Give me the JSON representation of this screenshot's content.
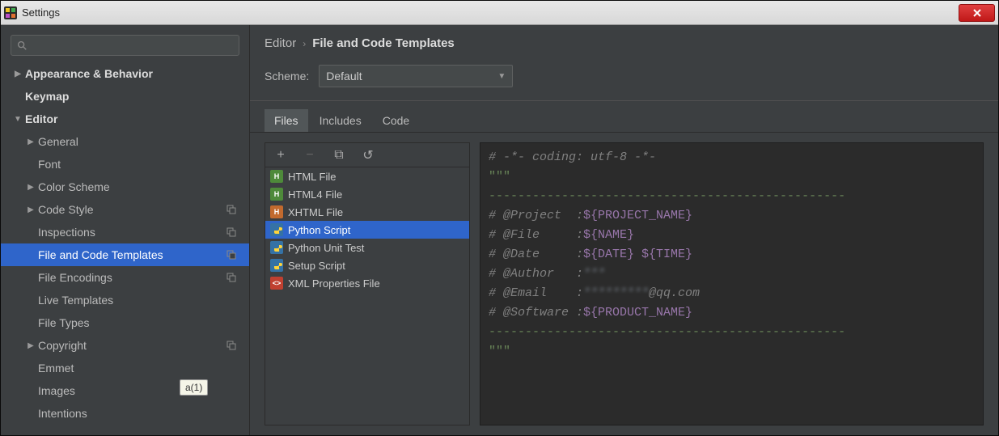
{
  "window": {
    "title": "Settings"
  },
  "sidebar": {
    "items": [
      {
        "label": "Appearance & Behavior",
        "arrow": "right",
        "bold": true,
        "level": 0
      },
      {
        "label": "Keymap",
        "arrow": "",
        "bold": true,
        "level": 0
      },
      {
        "label": "Editor",
        "arrow": "down",
        "bold": true,
        "level": 0
      },
      {
        "label": "General",
        "arrow": "right",
        "level": 1
      },
      {
        "label": "Font",
        "arrow": "",
        "level": 1
      },
      {
        "label": "Color Scheme",
        "arrow": "right",
        "level": 1
      },
      {
        "label": "Code Style",
        "arrow": "right",
        "level": 1,
        "tagged": true
      },
      {
        "label": "Inspections",
        "arrow": "",
        "level": 1,
        "tagged": true
      },
      {
        "label": "File and Code Templates",
        "arrow": "",
        "level": 1,
        "tagged": true,
        "selected": true
      },
      {
        "label": "File Encodings",
        "arrow": "",
        "level": 1,
        "tagged": true
      },
      {
        "label": "Live Templates",
        "arrow": "",
        "level": 1
      },
      {
        "label": "File Types",
        "arrow": "",
        "level": 1
      },
      {
        "label": "Copyright",
        "arrow": "right",
        "level": 1,
        "tagged": true
      },
      {
        "label": "Emmet",
        "arrow": "",
        "level": 1
      },
      {
        "label": "Images",
        "arrow": "",
        "level": 1
      },
      {
        "label": "Intentions",
        "arrow": "",
        "level": 1
      }
    ]
  },
  "breadcrumb": {
    "root": "Editor",
    "current": "File and Code Templates"
  },
  "scheme": {
    "label": "Scheme:",
    "value": "Default"
  },
  "tabs": [
    {
      "label": "Files",
      "active": true
    },
    {
      "label": "Includes"
    },
    {
      "label": "Code"
    }
  ],
  "templates": [
    {
      "label": "HTML File",
      "icon": "html"
    },
    {
      "label": "HTML4 File",
      "icon": "html"
    },
    {
      "label": "XHTML File",
      "icon": "xhtml"
    },
    {
      "label": "Python Script",
      "icon": "py",
      "selected": true
    },
    {
      "label": "Python Unit Test",
      "icon": "py"
    },
    {
      "label": "Setup Script",
      "icon": "py"
    },
    {
      "label": "XML Properties File",
      "icon": "xml"
    }
  ],
  "toolbar_icons": {
    "add": "+",
    "remove": "−",
    "copy": "⧉",
    "revert": "↺"
  },
  "code": {
    "l1_a": "# -*- coding: utf-8 -*-",
    "l2": "\"\"\"",
    "dash": "-------------------------------------------------",
    "l4_a": "# @Project  :",
    "l4_b": "${PROJECT_NAME}",
    "l5_a": "# @File     :",
    "l5_b": "${NAME}",
    "l6_a": "# @Date     :",
    "l6_b": "${DATE} ${TIME}",
    "l7_a": "# @Author   :",
    "l7_b": "***",
    "l8_a": "# @Email    :",
    "l8_b": "*********",
    "l8_c": "@qq.com",
    "l9_a": "# @Software :",
    "l9_b": "${PRODUCT_NAME}",
    "l11": "\"\"\""
  },
  "hint": "a(1)"
}
